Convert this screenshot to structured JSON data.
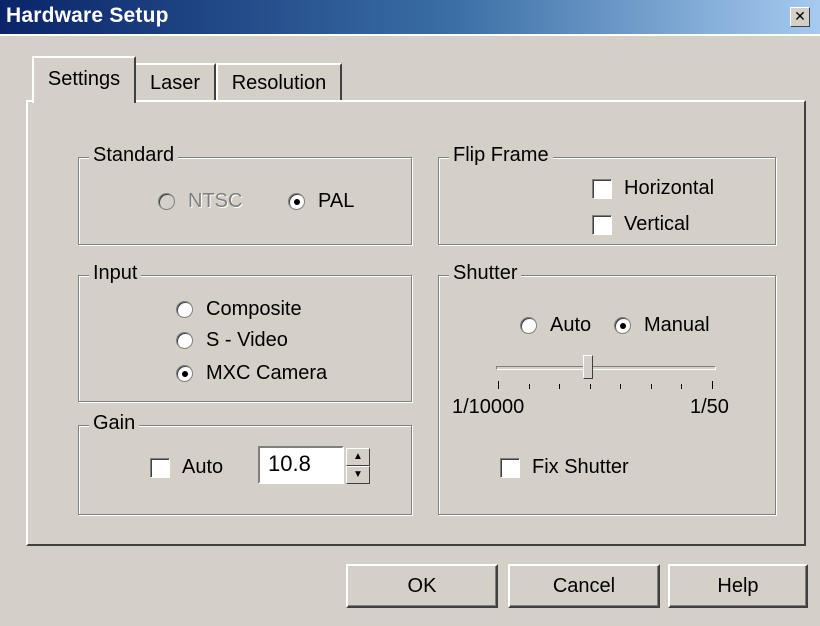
{
  "window": {
    "title": "Hardware Setup",
    "close_glyph": "✕"
  },
  "tabs": [
    {
      "label": "Settings",
      "active": true
    },
    {
      "label": "Laser",
      "active": false
    },
    {
      "label": "Resolution",
      "active": false
    }
  ],
  "standard": {
    "legend": "Standard",
    "options": [
      {
        "label": "NTSC",
        "selected": false,
        "disabled": true
      },
      {
        "label": "PAL",
        "selected": true,
        "disabled": false
      }
    ]
  },
  "flip_frame": {
    "legend": "Flip Frame",
    "options": [
      {
        "label": "Horizontal",
        "checked": false
      },
      {
        "label": "Vertical",
        "checked": false
      }
    ]
  },
  "input": {
    "legend": "Input",
    "options": [
      {
        "label": "Composite",
        "selected": false
      },
      {
        "label": "S - Video",
        "selected": false
      },
      {
        "label": "MXC Camera",
        "selected": true
      }
    ]
  },
  "shutter": {
    "legend": "Shutter",
    "mode_options": [
      {
        "label": "Auto",
        "selected": false
      },
      {
        "label": "Manual",
        "selected": true
      }
    ],
    "slider": {
      "min_label": "1/10000",
      "max_label": "1/50",
      "position_fraction": 0.42
    },
    "fix_shutter": {
      "label": "Fix Shutter",
      "checked": false
    }
  },
  "gain": {
    "legend": "Gain",
    "auto": {
      "label": "Auto",
      "checked": false
    },
    "value": "10.8"
  },
  "buttons": {
    "ok": "OK",
    "cancel": "Cancel",
    "help": "Help"
  }
}
